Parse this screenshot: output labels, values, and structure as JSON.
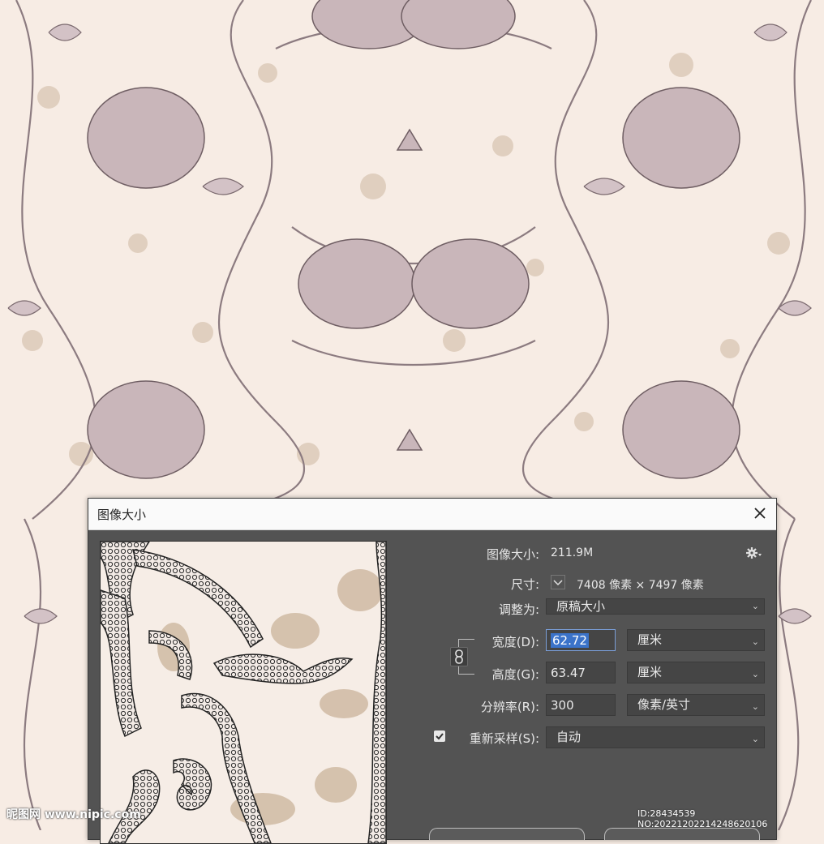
{
  "dialog": {
    "title": "图像大小",
    "image_size_label": "图像大小:",
    "image_size_value": "211.9M",
    "dimensions_label": "尺寸:",
    "dimensions_value": "7408 像素 × 7497 像素",
    "fit_to_label": "调整为:",
    "fit_to_value": "原稿大小",
    "width_label": "宽度(D):",
    "width_value": "62.72",
    "width_unit": "厘米",
    "height_label": "高度(G):",
    "height_value": "63.47",
    "height_unit": "厘米",
    "resolution_label": "分辨率(R):",
    "resolution_value": "300",
    "resolution_unit": "像素/英寸",
    "resample_label": "重新采样(S):",
    "resample_checked": true,
    "resample_value": "自动"
  },
  "icons": {
    "close": "close-icon",
    "settings": "gear-icon",
    "dimensions_toggle": "chevron-down-icon",
    "link": "chain-link-icon",
    "dropdown": "chevron-down-icon",
    "checkbox": "check-icon"
  },
  "watermark": {
    "site": "昵图网 www.nipic.com",
    "id": "ID:28434539 NO:20221202214248620106"
  },
  "colors": {
    "dialog_bg": "#535353",
    "field_bg": "#454545",
    "selection": "#3b73c9",
    "pattern_bg": "#f7ece4",
    "pattern_line": "#8c7b80"
  }
}
